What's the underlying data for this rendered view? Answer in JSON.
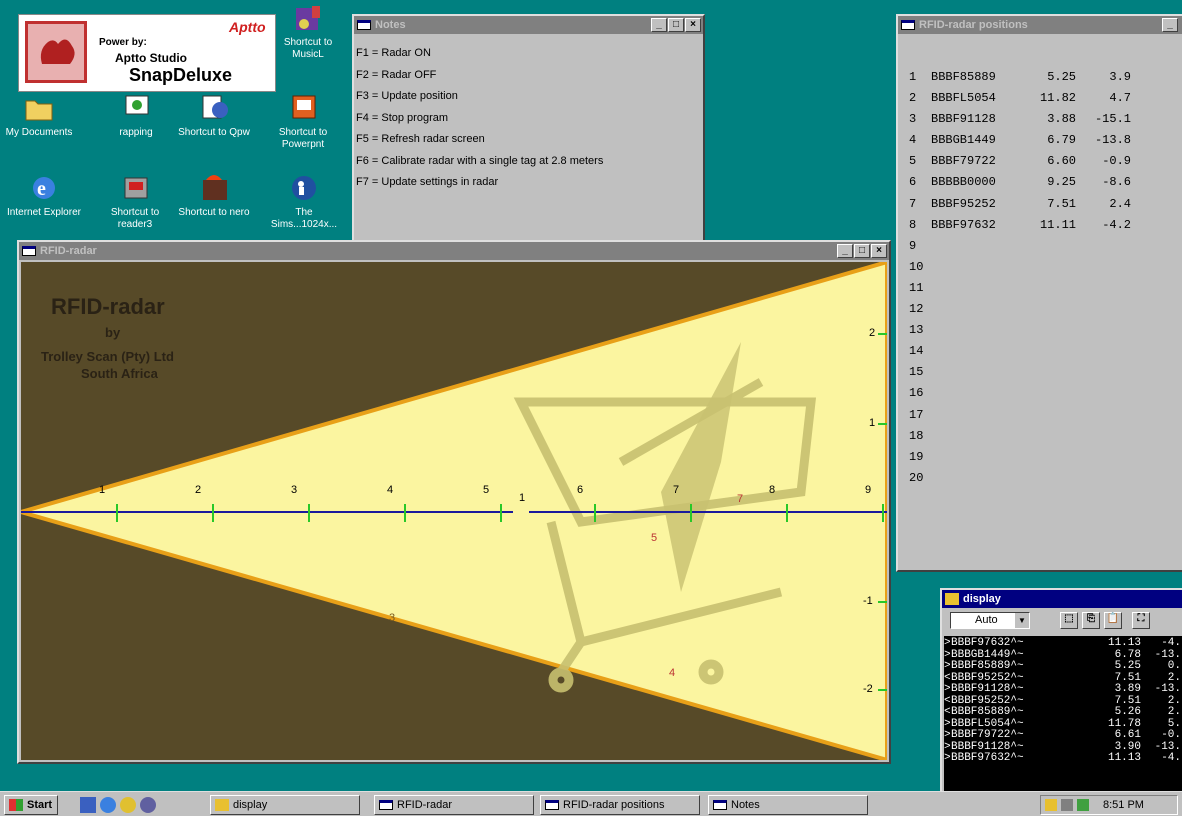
{
  "desktop_icons": [
    {
      "id": "music",
      "label": "Shortcut to MusicL",
      "icon": "music-shortcut-icon"
    },
    {
      "id": "mydocs",
      "label": "My Documents",
      "icon": "folder-icon"
    },
    {
      "id": "rapping",
      "label": "rapping",
      "icon": "app-icon"
    },
    {
      "id": "qpw",
      "label": "Shortcut to Qpw",
      "icon": "qpw-shortcut-icon"
    },
    {
      "id": "powerpnt",
      "label": "Shortcut to Powerpnt",
      "icon": "powerpoint-shortcut-icon"
    },
    {
      "id": "ie",
      "label": "Internet Explorer",
      "icon": "internet-explorer-icon"
    },
    {
      "id": "reader3",
      "label": "Shortcut to reader3",
      "icon": "reader-shortcut-icon"
    },
    {
      "id": "nero",
      "label": "Shortcut to nero",
      "icon": "nero-shortcut-icon"
    },
    {
      "id": "sims",
      "label": "The Sims...1024x...",
      "icon": "sims-icon"
    }
  ],
  "aptto": {
    "power_by": "Power by:",
    "studio": "Aptto Studio",
    "product": "SnapDeluxe",
    "brand": "Aptto"
  },
  "notes_window": {
    "title": "Notes",
    "lines": [
      "F1 = Radar ON",
      "F2 = Radar OFF",
      "F3 = Update position",
      "F4 = Stop program",
      "F5 = Refresh radar screen",
      "F6 = Calibrate radar with a single tag at 2.8 meters",
      "F7 = Update settings in radar"
    ]
  },
  "radar_window": {
    "title": "RFID-radar",
    "heading": "RFID-radar",
    "by": "by",
    "company": "Trolley Scan (Pty) Ltd",
    "country": "South Africa",
    "axis_ticks": [
      "1",
      "2",
      "3",
      "4",
      "5",
      "6",
      "7",
      "8",
      "9"
    ],
    "y_ticks": [
      "2",
      "1",
      "-1",
      "-2"
    ],
    "tags": [
      "1",
      "7",
      "5",
      "3",
      "4"
    ]
  },
  "positions_window": {
    "title": "RFID-radar positions",
    "rows": [
      {
        "n": "1",
        "id": "BBBF85889",
        "x": "5.25",
        "y": "3.9"
      },
      {
        "n": "2",
        "id": "BBBFL5054",
        "x": "11.82",
        "y": "4.7"
      },
      {
        "n": "3",
        "id": "BBBF91128",
        "x": "3.88",
        "y": "-15.1"
      },
      {
        "n": "4",
        "id": "BBBGB1449",
        "x": "6.79",
        "y": "-13.8"
      },
      {
        "n": "5",
        "id": "BBBF79722",
        "x": "6.60",
        "y": "-0.9"
      },
      {
        "n": "6",
        "id": "BBBBB0000",
        "x": "9.25",
        "y": "-8.6"
      },
      {
        "n": "7",
        "id": "BBBF95252",
        "x": "7.51",
        "y": "2.4"
      },
      {
        "n": "8",
        "id": "BBBF97632",
        "x": "11.11",
        "y": "-4.2"
      },
      {
        "n": "9",
        "id": "",
        "x": "",
        "y": ""
      },
      {
        "n": "10",
        "id": "",
        "x": "",
        "y": ""
      },
      {
        "n": "11",
        "id": "",
        "x": "",
        "y": ""
      },
      {
        "n": "12",
        "id": "",
        "x": "",
        "y": ""
      },
      {
        "n": "13",
        "id": "",
        "x": "",
        "y": ""
      },
      {
        "n": "14",
        "id": "",
        "x": "",
        "y": ""
      },
      {
        "n": "15",
        "id": "",
        "x": "",
        "y": ""
      },
      {
        "n": "16",
        "id": "",
        "x": "",
        "y": ""
      },
      {
        "n": "17",
        "id": "",
        "x": "",
        "y": ""
      },
      {
        "n": "18",
        "id": "",
        "x": "",
        "y": ""
      },
      {
        "n": "19",
        "id": "",
        "x": "",
        "y": ""
      },
      {
        "n": "20",
        "id": "",
        "x": "",
        "y": ""
      }
    ]
  },
  "display_window": {
    "title": "display",
    "select_value": "Auto",
    "rows": [
      {
        "dir": ">",
        "id": "BBBF97632^~",
        "x": "11.13",
        "y": "-4."
      },
      {
        "dir": ">",
        "id": "BBBGB1449^~",
        "x": "6.78",
        "y": "-13."
      },
      {
        "dir": ">",
        "id": "BBBF85889^~",
        "x": "5.25",
        "y": "0."
      },
      {
        "dir": "<",
        "id": "BBBF95252^~",
        "x": "7.51",
        "y": "2."
      },
      {
        "dir": ">",
        "id": "BBBF91128^~",
        "x": "3.89",
        "y": "-13."
      },
      {
        "dir": "<",
        "id": "BBBF95252^~",
        "x": "7.51",
        "y": "2."
      },
      {
        "dir": "<",
        "id": "BBBF85889^~",
        "x": "5.26",
        "y": "2."
      },
      {
        "dir": ">",
        "id": "BBBFL5054^~",
        "x": "11.78",
        "y": "5."
      },
      {
        "dir": ">",
        "id": "BBBF79722^~",
        "x": "6.61",
        "y": "-0."
      },
      {
        "dir": ">",
        "id": "BBBF91128^~",
        "x": "3.90",
        "y": "-13."
      },
      {
        "dir": ">",
        "id": "BBBF97632^~",
        "x": "11.13",
        "y": "-4."
      }
    ]
  },
  "taskbar": {
    "start": "Start",
    "tasks": [
      "display",
      "RFID-radar",
      "RFID-radar positions",
      "Notes"
    ],
    "clock": "8:51 PM"
  },
  "colors": {
    "desktop": "#008080",
    "radar_fill": "#fbf5a0",
    "radar_dark": "#574a28",
    "axis": "#1a1a9c",
    "tick": "#28c828"
  }
}
